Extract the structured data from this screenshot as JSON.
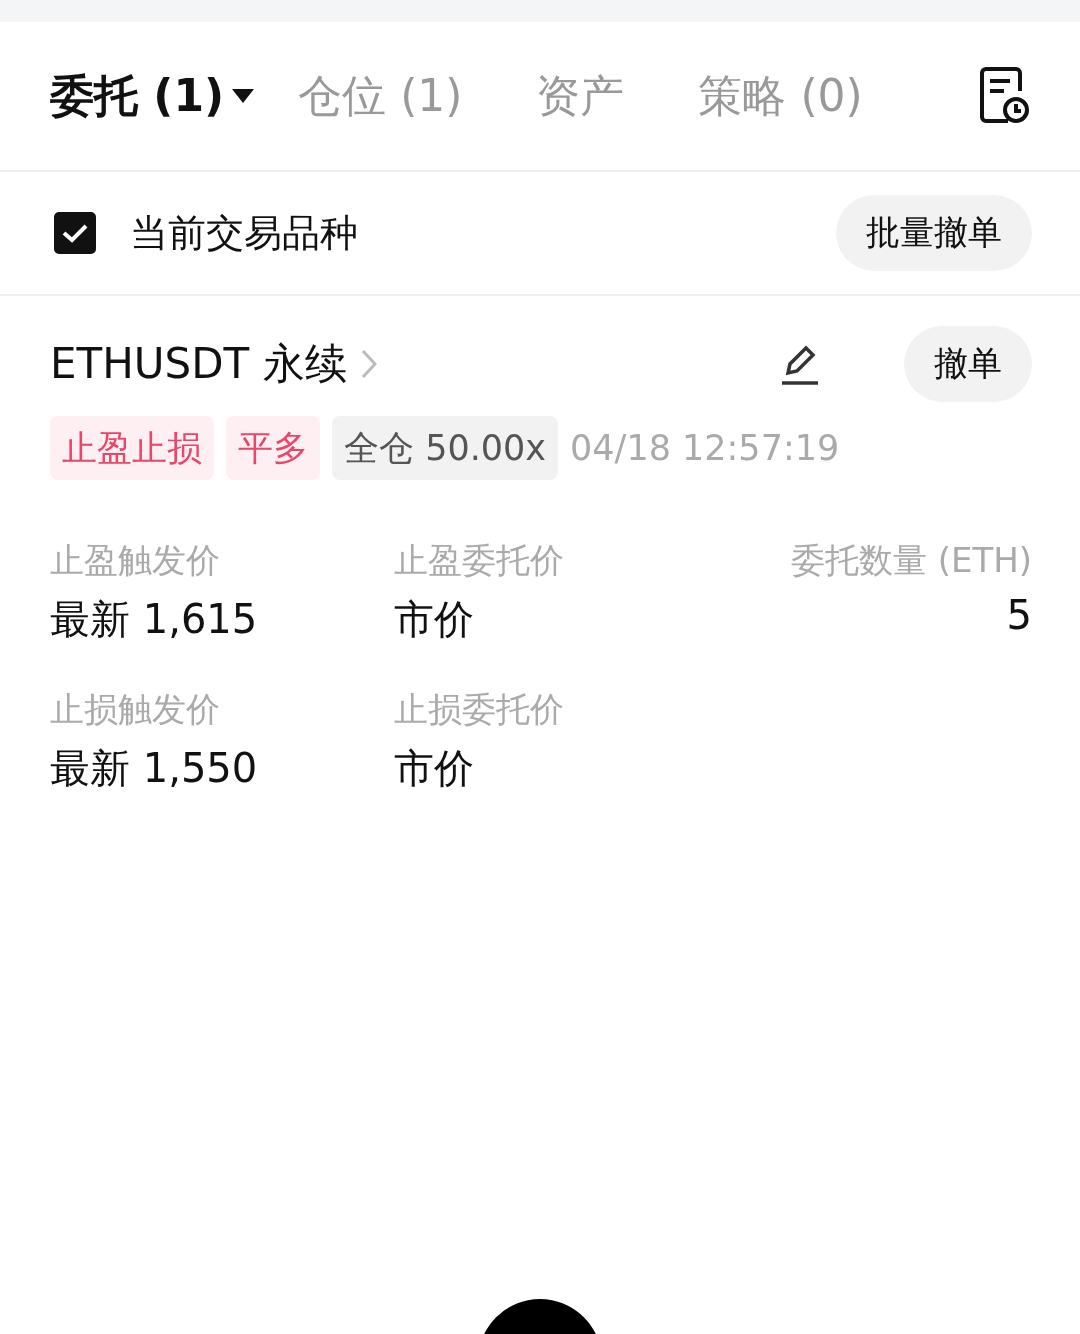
{
  "tabs": [
    {
      "label": "委托 (1)",
      "selected": true,
      "dropdown": true
    },
    {
      "label": "仓位 (1)",
      "selected": false,
      "dropdown": false
    },
    {
      "label": "资产",
      "selected": false,
      "dropdown": false
    },
    {
      "label": "策略 (0)",
      "selected": false,
      "dropdown": false
    }
  ],
  "filter": {
    "label": "当前交易品种",
    "checked": true
  },
  "batch_cancel": "批量撤单",
  "orders": [
    {
      "symbol": "ETHUSDT 永续",
      "cancel": "撤单",
      "tags": [
        {
          "label": "止盈止损",
          "kind": "alert"
        },
        {
          "label": "平多",
          "kind": "alert"
        },
        {
          "label": "全仓 50.00x",
          "kind": "neutral"
        }
      ],
      "time": "04/18 12:57:19",
      "fields": [
        {
          "label": "止盈触发价",
          "value": "最新 1,615"
        },
        {
          "label": "止盈委托价",
          "value": "市价"
        },
        {
          "label": "委托数量 (ETH)",
          "value": "5"
        },
        {
          "label": "止损触发价",
          "value": "最新 1,550"
        },
        {
          "label": "止损委托价",
          "value": "市价"
        }
      ]
    }
  ]
}
